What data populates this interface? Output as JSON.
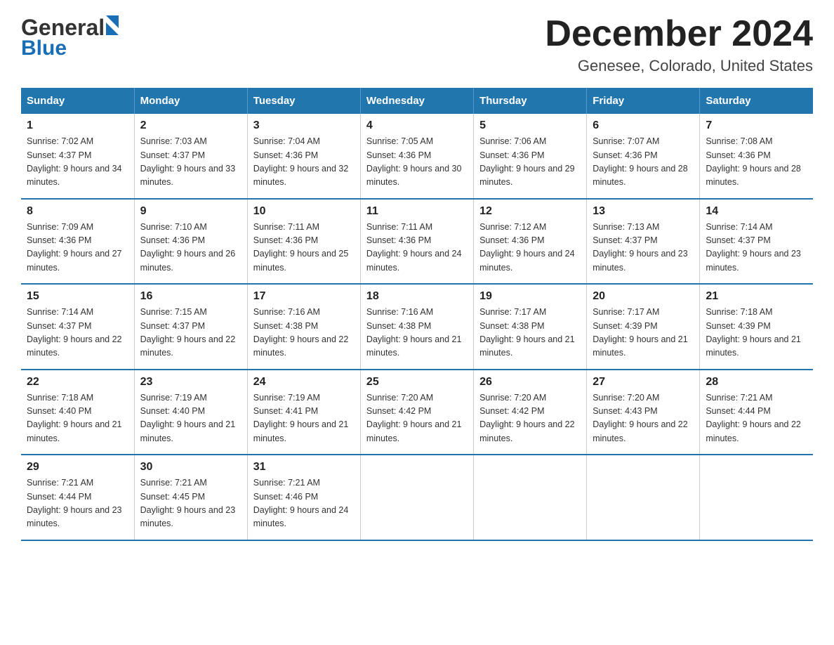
{
  "header": {
    "logo_line1": "General",
    "logo_line2": "Blue",
    "title": "December 2024",
    "subtitle": "Genesee, Colorado, United States"
  },
  "weekdays": [
    "Sunday",
    "Monday",
    "Tuesday",
    "Wednesday",
    "Thursday",
    "Friday",
    "Saturday"
  ],
  "weeks": [
    [
      {
        "day": "1",
        "sunrise": "7:02 AM",
        "sunset": "4:37 PM",
        "daylight": "9 hours and 34 minutes."
      },
      {
        "day": "2",
        "sunrise": "7:03 AM",
        "sunset": "4:37 PM",
        "daylight": "9 hours and 33 minutes."
      },
      {
        "day": "3",
        "sunrise": "7:04 AM",
        "sunset": "4:36 PM",
        "daylight": "9 hours and 32 minutes."
      },
      {
        "day": "4",
        "sunrise": "7:05 AM",
        "sunset": "4:36 PM",
        "daylight": "9 hours and 30 minutes."
      },
      {
        "day": "5",
        "sunrise": "7:06 AM",
        "sunset": "4:36 PM",
        "daylight": "9 hours and 29 minutes."
      },
      {
        "day": "6",
        "sunrise": "7:07 AM",
        "sunset": "4:36 PM",
        "daylight": "9 hours and 28 minutes."
      },
      {
        "day": "7",
        "sunrise": "7:08 AM",
        "sunset": "4:36 PM",
        "daylight": "9 hours and 28 minutes."
      }
    ],
    [
      {
        "day": "8",
        "sunrise": "7:09 AM",
        "sunset": "4:36 PM",
        "daylight": "9 hours and 27 minutes."
      },
      {
        "day": "9",
        "sunrise": "7:10 AM",
        "sunset": "4:36 PM",
        "daylight": "9 hours and 26 minutes."
      },
      {
        "day": "10",
        "sunrise": "7:11 AM",
        "sunset": "4:36 PM",
        "daylight": "9 hours and 25 minutes."
      },
      {
        "day": "11",
        "sunrise": "7:11 AM",
        "sunset": "4:36 PM",
        "daylight": "9 hours and 24 minutes."
      },
      {
        "day": "12",
        "sunrise": "7:12 AM",
        "sunset": "4:36 PM",
        "daylight": "9 hours and 24 minutes."
      },
      {
        "day": "13",
        "sunrise": "7:13 AM",
        "sunset": "4:37 PM",
        "daylight": "9 hours and 23 minutes."
      },
      {
        "day": "14",
        "sunrise": "7:14 AM",
        "sunset": "4:37 PM",
        "daylight": "9 hours and 23 minutes."
      }
    ],
    [
      {
        "day": "15",
        "sunrise": "7:14 AM",
        "sunset": "4:37 PM",
        "daylight": "9 hours and 22 minutes."
      },
      {
        "day": "16",
        "sunrise": "7:15 AM",
        "sunset": "4:37 PM",
        "daylight": "9 hours and 22 minutes."
      },
      {
        "day": "17",
        "sunrise": "7:16 AM",
        "sunset": "4:38 PM",
        "daylight": "9 hours and 22 minutes."
      },
      {
        "day": "18",
        "sunrise": "7:16 AM",
        "sunset": "4:38 PM",
        "daylight": "9 hours and 21 minutes."
      },
      {
        "day": "19",
        "sunrise": "7:17 AM",
        "sunset": "4:38 PM",
        "daylight": "9 hours and 21 minutes."
      },
      {
        "day": "20",
        "sunrise": "7:17 AM",
        "sunset": "4:39 PM",
        "daylight": "9 hours and 21 minutes."
      },
      {
        "day": "21",
        "sunrise": "7:18 AM",
        "sunset": "4:39 PM",
        "daylight": "9 hours and 21 minutes."
      }
    ],
    [
      {
        "day": "22",
        "sunrise": "7:18 AM",
        "sunset": "4:40 PM",
        "daylight": "9 hours and 21 minutes."
      },
      {
        "day": "23",
        "sunrise": "7:19 AM",
        "sunset": "4:40 PM",
        "daylight": "9 hours and 21 minutes."
      },
      {
        "day": "24",
        "sunrise": "7:19 AM",
        "sunset": "4:41 PM",
        "daylight": "9 hours and 21 minutes."
      },
      {
        "day": "25",
        "sunrise": "7:20 AM",
        "sunset": "4:42 PM",
        "daylight": "9 hours and 21 minutes."
      },
      {
        "day": "26",
        "sunrise": "7:20 AM",
        "sunset": "4:42 PM",
        "daylight": "9 hours and 22 minutes."
      },
      {
        "day": "27",
        "sunrise": "7:20 AM",
        "sunset": "4:43 PM",
        "daylight": "9 hours and 22 minutes."
      },
      {
        "day": "28",
        "sunrise": "7:21 AM",
        "sunset": "4:44 PM",
        "daylight": "9 hours and 22 minutes."
      }
    ],
    [
      {
        "day": "29",
        "sunrise": "7:21 AM",
        "sunset": "4:44 PM",
        "daylight": "9 hours and 23 minutes."
      },
      {
        "day": "30",
        "sunrise": "7:21 AM",
        "sunset": "4:45 PM",
        "daylight": "9 hours and 23 minutes."
      },
      {
        "day": "31",
        "sunrise": "7:21 AM",
        "sunset": "4:46 PM",
        "daylight": "9 hours and 24 minutes."
      },
      null,
      null,
      null,
      null
    ]
  ]
}
